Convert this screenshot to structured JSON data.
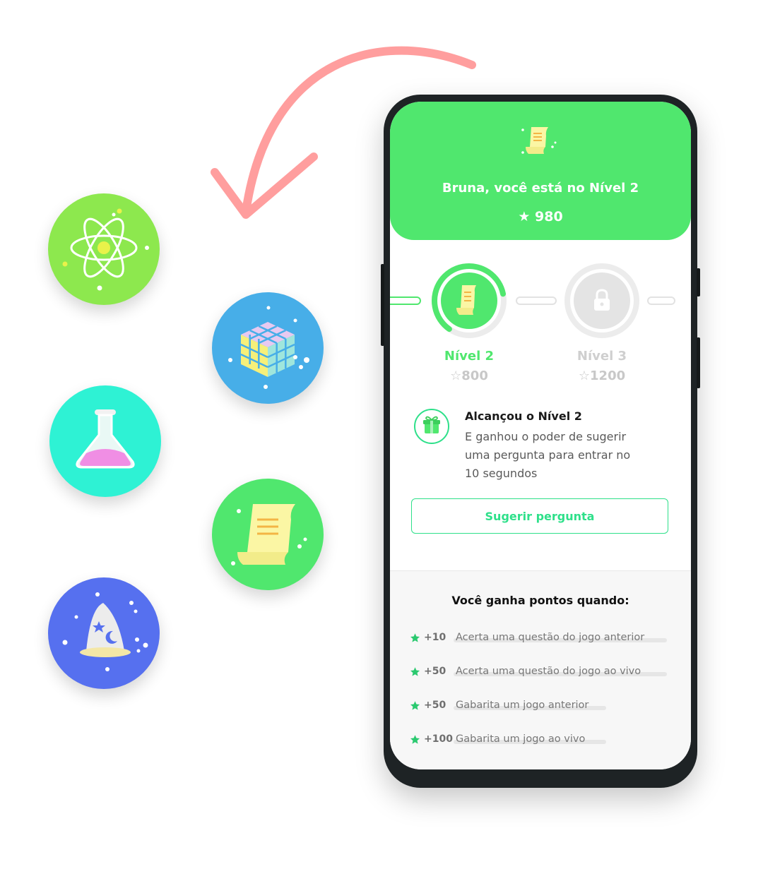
{
  "hero": {
    "title": "Bruna, você está no Nível 2",
    "score": "980"
  },
  "levels": [
    {
      "label": "Nível 2",
      "points": "800",
      "state": "current",
      "progress": 0.62
    },
    {
      "label": "Nível 3",
      "points": "1200",
      "state": "locked",
      "progress": 0
    }
  ],
  "reward": {
    "title": "Alcançou o Nível 2",
    "description": "E ganhou o poder de sugerir uma pergunta para entrar no 10 segundos"
  },
  "suggest_button": "Sugerir pergunta",
  "earn": {
    "title": "Você ganha pontos quando:",
    "rules": [
      {
        "points": "+10",
        "text": "Acerta uma questão do jogo anterior"
      },
      {
        "points": "+50",
        "text": "Acerta uma questão do jogo ao vivo"
      },
      {
        "points": "+50",
        "text": "Gabarita um jogo anterior"
      },
      {
        "points": "+100",
        "text": "Gabarita um jogo ao vivo"
      }
    ]
  },
  "badges": [
    "atom-icon",
    "rubiks-cube-icon",
    "flask-icon",
    "scroll-icon",
    "wizard-hat-icon"
  ],
  "colors": {
    "accent_green": "#50e76e",
    "mint": "#2ee08a",
    "arrow": "#ff9e9e"
  }
}
